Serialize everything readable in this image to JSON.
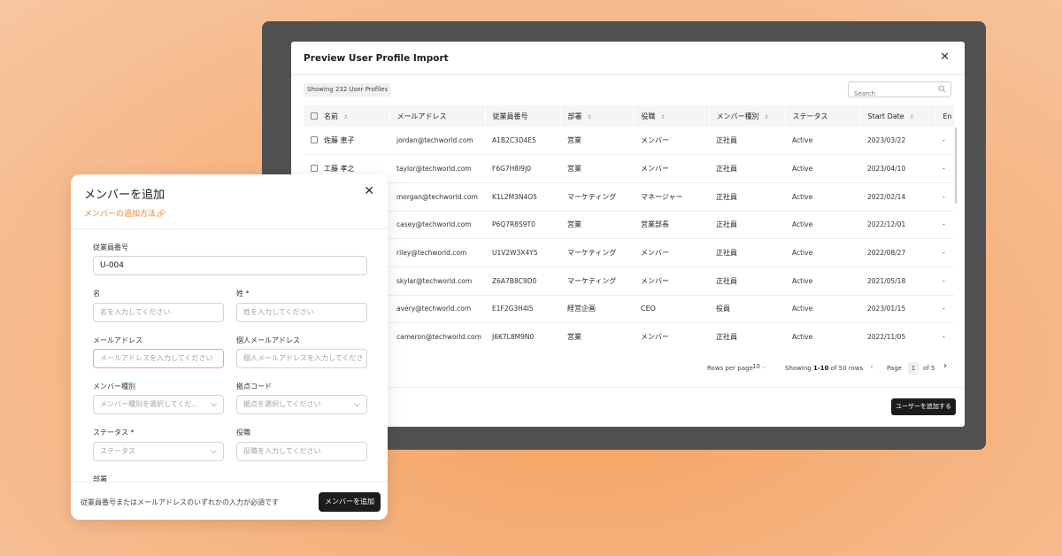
{
  "import_panel": {
    "title": "Preview User Profile Import",
    "showing_badge": "Showing 232 User Profiles",
    "search_placeholder": "Search",
    "columns": [
      "名前",
      "メールアドレス",
      "従業員番号",
      "部署",
      "役職",
      "メンバー種別",
      "ステータス",
      "Start Date",
      "En"
    ],
    "rows": [
      {
        "name": "佐藤 恵子",
        "email": "jordan@techworld.com",
        "emp_no": "A1B2C3D4E5",
        "dept": "営業",
        "title": "メンバー",
        "type": "正社員",
        "status": "Active",
        "start": "2023/03/22",
        "end": "-"
      },
      {
        "name": "工藤 孝之",
        "email": "taylor@techworld.com",
        "emp_no": "F6G7H8I9J0",
        "dept": "営業",
        "title": "メンバー",
        "type": "正社員",
        "status": "Active",
        "start": "2023/04/10",
        "end": "-"
      },
      {
        "name": "",
        "email": "morgan@techworld.com",
        "emp_no": "K1L2M3N4O5",
        "dept": "マーケティング",
        "title": "マネージャー",
        "type": "正社員",
        "status": "Active",
        "start": "2022/02/14",
        "end": "-"
      },
      {
        "name": "",
        "email": "casey@techworld.com",
        "emp_no": "P6Q7R8S9T0",
        "dept": "営業",
        "title": "営業部長",
        "type": "正社員",
        "status": "Active",
        "start": "2022/12/01",
        "end": "-"
      },
      {
        "name": "",
        "email": "riley@techworld.com",
        "emp_no": "U1V2W3X4Y5",
        "dept": "マーケティング",
        "title": "メンバー",
        "type": "正社員",
        "status": "Active",
        "start": "2022/08/27",
        "end": "-"
      },
      {
        "name": "",
        "email": "skylar@techworld.com",
        "emp_no": "Z6A7B8C9D0",
        "dept": "マーケティング",
        "title": "メンバー",
        "type": "正社員",
        "status": "Active",
        "start": "2021/05/18",
        "end": "-"
      },
      {
        "name": "",
        "email": "avery@techworld.com",
        "emp_no": "E1F2G3H4I5",
        "dept": "経営企画",
        "title": "CEO",
        "type": "役員",
        "status": "Active",
        "start": "2023/01/15",
        "end": "-"
      },
      {
        "name": "",
        "email": "cameron@techworld.com",
        "emp_no": "J6K7L8M9N0",
        "dept": "営業",
        "title": "メンバー",
        "type": "正社員",
        "status": "Active",
        "start": "2022/11/05",
        "end": "-"
      }
    ],
    "pagination": {
      "rows_per_page_label": "Rows per page",
      "rows_per_page_value": "10",
      "showing_prefix": "Showing ",
      "showing_range": "1-10",
      "showing_suffix": " of 50 rows",
      "page_label": "Page",
      "page_number": "1",
      "page_of": "of 5"
    },
    "add_user_button": "ユーザーを追加する"
  },
  "member_modal": {
    "title": "メンバーを追加",
    "help_link": "メンバーの追加方法",
    "fields": {
      "employee_no": {
        "label": "従業員番号",
        "value": "U-004"
      },
      "first_name": {
        "label": "名",
        "placeholder": "名を入力してください"
      },
      "last_name": {
        "label": "姓 *",
        "placeholder": "姓を入力してください"
      },
      "email": {
        "label": "メールアドレス",
        "placeholder": "メールアドレスを入力してください"
      },
      "personal_email": {
        "label": "個人メールアドレス",
        "placeholder": "個人メールアドレスを入力してくださ"
      },
      "member_type": {
        "label": "メンバー種別",
        "placeholder": "メンバー種別を選択してくだ..."
      },
      "location_code": {
        "label": "拠点コード",
        "placeholder": "拠点を選択してください"
      },
      "status": {
        "label": "ステータス *",
        "placeholder": "ステータス"
      },
      "position": {
        "label": "役職",
        "placeholder": "役職を入力してください"
      },
      "department": {
        "label": "部署"
      }
    },
    "footnote": "従業員番号またはメールアドレスのいずれかの入力が必須です",
    "add_button": "メンバーを追加"
  },
  "colors": {
    "accent": "#e08a3c",
    "button_dark": "#1c1c1c",
    "frame": "#505050"
  }
}
